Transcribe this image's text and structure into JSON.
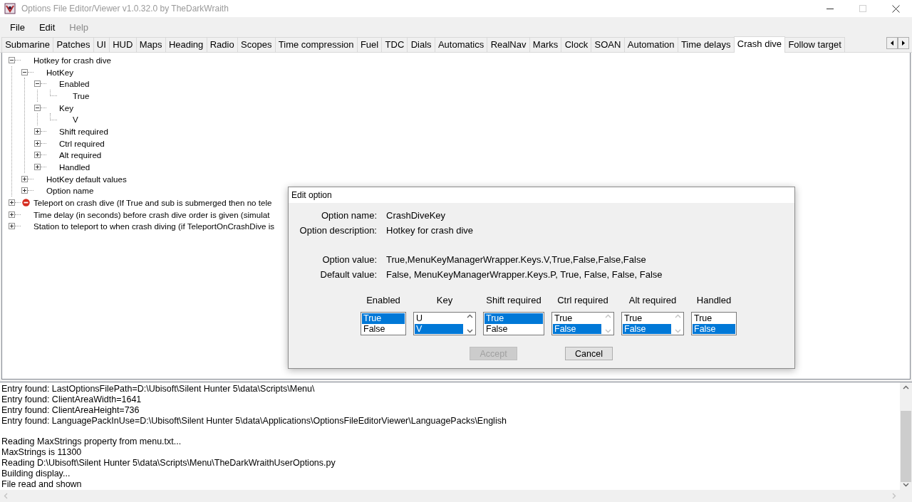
{
  "window": {
    "title": "Options File Editor/Viewer v1.0.32.0 by TheDarkWraith"
  },
  "menu": [
    {
      "label": "File",
      "disabled": false
    },
    {
      "label": "Edit",
      "disabled": false
    },
    {
      "label": "Help",
      "disabled": true
    }
  ],
  "tabs": [
    {
      "label": "Submarine",
      "selected": false
    },
    {
      "label": "Patches",
      "selected": false
    },
    {
      "label": "UI",
      "selected": false
    },
    {
      "label": "HUD",
      "selected": false
    },
    {
      "label": "Maps",
      "selected": false
    },
    {
      "label": "Heading",
      "selected": false
    },
    {
      "label": "Radio",
      "selected": false
    },
    {
      "label": "Scopes",
      "selected": false
    },
    {
      "label": "Time compression",
      "selected": false
    },
    {
      "label": "Fuel",
      "selected": false
    },
    {
      "label": "TDC",
      "selected": false
    },
    {
      "label": "Dials",
      "selected": false
    },
    {
      "label": "Automatics",
      "selected": false
    },
    {
      "label": "RealNav",
      "selected": false
    },
    {
      "label": "Marks",
      "selected": false
    },
    {
      "label": "Clock",
      "selected": false
    },
    {
      "label": "SOAN",
      "selected": false
    },
    {
      "label": "Automation",
      "selected": false
    },
    {
      "label": "Time delays",
      "selected": false
    },
    {
      "label": "Crash dive",
      "selected": true
    },
    {
      "label": "Follow target",
      "selected": false
    }
  ],
  "tree": [
    {
      "label": "Hotkey for crash dive",
      "expanded": true,
      "children": [
        {
          "label": "HotKey",
          "expanded": true,
          "children": [
            {
              "label": "Enabled",
              "expanded": true,
              "children": [
                {
                  "label": "True"
                }
              ]
            },
            {
              "label": "Key",
              "expanded": true,
              "children": [
                {
                  "label": "V"
                }
              ]
            },
            {
              "label": "Shift required",
              "expanded": false
            },
            {
              "label": "Ctrl required",
              "expanded": false
            },
            {
              "label": "Alt required",
              "expanded": false
            },
            {
              "label": "Handled",
              "expanded": false
            }
          ]
        },
        {
          "label": "HotKey default values",
          "expanded": false
        },
        {
          "label": "Option name",
          "expanded": false
        }
      ]
    },
    {
      "label": "Teleport on crash dive (If True and sub is submerged then no tele",
      "expanded": false,
      "error": true
    },
    {
      "label": "Time delay (in seconds) before crash dive order is given (simulat",
      "expanded": false
    },
    {
      "label": "Station to teleport to when crash diving (if TeleportOnCrashDive is",
      "expanded": false
    }
  ],
  "log": {
    "blocks": [
      [
        "Entry found: LastOptionsFilePath=D:\\Ubisoft\\Silent Hunter 5\\data\\Scripts\\Menu\\",
        "Entry found: ClientAreaWidth=1641",
        "Entry found: ClientAreaHeight=736",
        "Entry found: LanguagePackInUse=D:\\Ubisoft\\Silent Hunter 5\\data\\Applications\\OptionsFileEditorViewer\\LanguagePacks\\English"
      ],
      [
        "Reading MaxStrings property from menu.txt...",
        "MaxStrings is 11300",
        "Reading D:\\Ubisoft\\Silent Hunter 5\\data\\Scripts\\Menu\\TheDarkWraithUserOptions.py",
        "Building display...",
        "File read and shown"
      ]
    ]
  },
  "dialog": {
    "title": "Edit option",
    "info": [
      {
        "label": "Option name:",
        "value": "CrashDiveKey"
      },
      {
        "label": "Option description:",
        "value": "Hotkey for crash dive"
      }
    ],
    "values": [
      {
        "label": "Option value:",
        "value": "True,MenuKeyManagerWrapper.Keys.V,True,False,False,False"
      },
      {
        "label": "Default value:",
        "value": "False, MenuKeyManagerWrapper.Keys.P, True, False, False, False"
      }
    ],
    "lists": [
      {
        "heading": "Enabled",
        "scrollbar": false,
        "options": [
          {
            "label": "True",
            "selected": true
          },
          {
            "label": "False",
            "selected": false
          }
        ]
      },
      {
        "heading": "Key",
        "scrollbar": true,
        "scrollbar_disabled": false,
        "options": [
          {
            "label": "U",
            "selected": false
          },
          {
            "label": "V",
            "selected": true
          }
        ]
      },
      {
        "heading": "Shift required",
        "scrollbar": false,
        "options": [
          {
            "label": "True",
            "selected": true
          },
          {
            "label": "False",
            "selected": false
          }
        ]
      },
      {
        "heading": "Ctrl required",
        "scrollbar": true,
        "scrollbar_disabled": true,
        "options": [
          {
            "label": "True",
            "selected": false
          },
          {
            "label": "False",
            "selected": true
          }
        ]
      },
      {
        "heading": "Alt required",
        "scrollbar": true,
        "scrollbar_disabled": true,
        "options": [
          {
            "label": "True",
            "selected": false
          },
          {
            "label": "False",
            "selected": true
          }
        ]
      },
      {
        "heading": "Handled",
        "scrollbar": false,
        "options": [
          {
            "label": "True",
            "selected": false
          },
          {
            "label": "False",
            "selected": true
          }
        ]
      }
    ],
    "buttons": [
      {
        "label": "Accept",
        "disabled": true
      },
      {
        "label": "Cancel",
        "disabled": false
      }
    ]
  }
}
